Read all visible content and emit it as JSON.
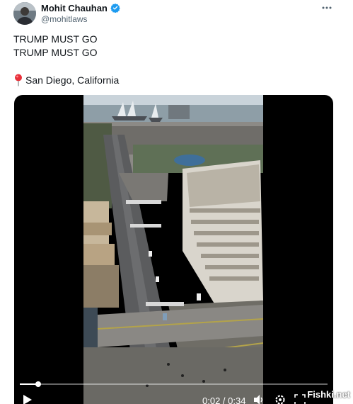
{
  "author": {
    "display_name": "Mohit Chauhan",
    "handle": "@mohitlaws",
    "verified_color": "#1d9bf0"
  },
  "tweet": {
    "line1": "TRUMP MUST GO",
    "line2": "TRUMP MUST GO",
    "location_icon": "round-pushpin-icon",
    "location": "San Diego, California"
  },
  "video": {
    "time": "0:02 / 0:34",
    "progress_fraction": 0.06
  },
  "watermark": "Fishki.net"
}
